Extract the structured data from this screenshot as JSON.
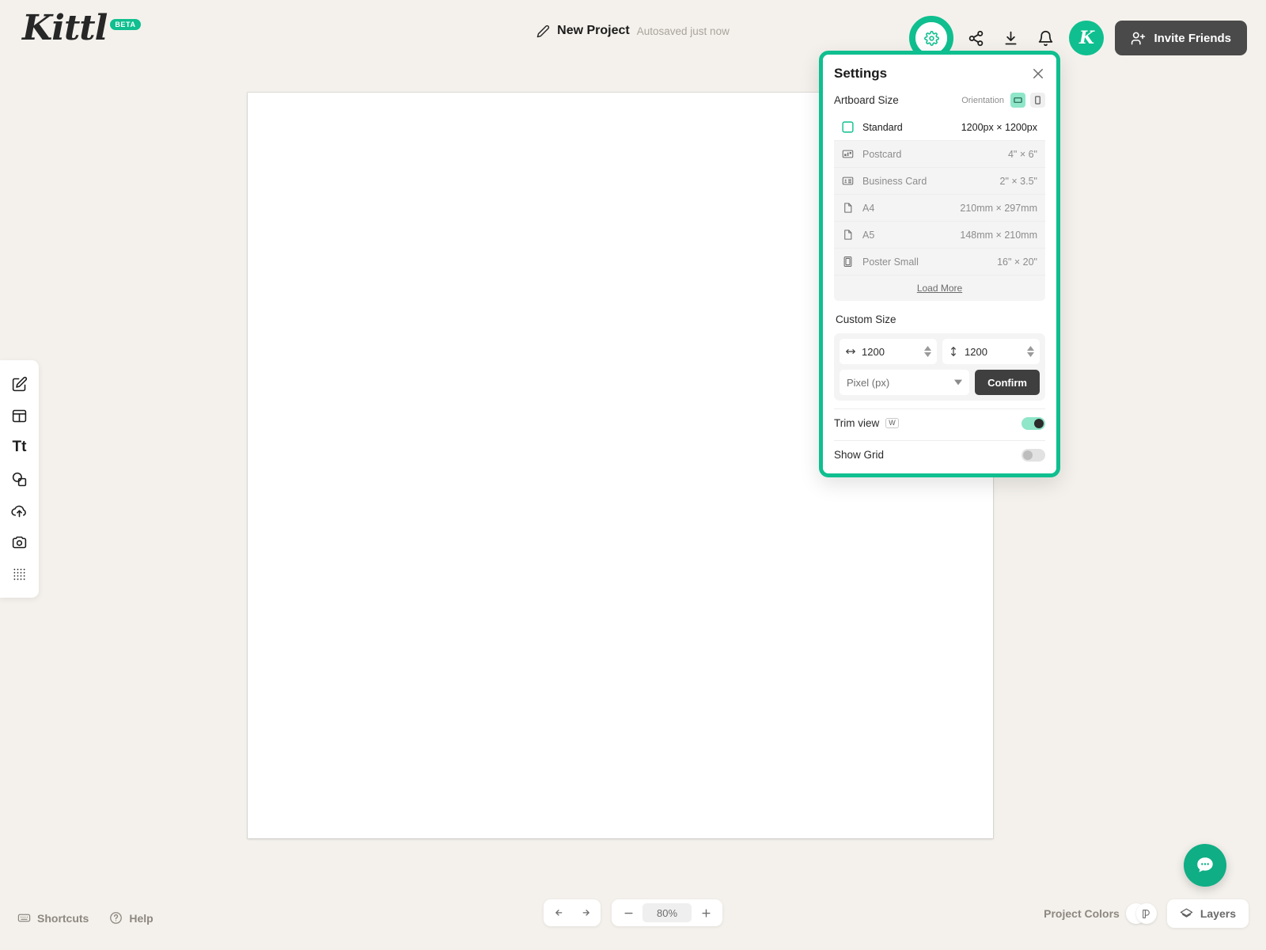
{
  "brand": {
    "name": "Kittl",
    "badge": "BETA",
    "accent": "#0fbf8f"
  },
  "header": {
    "project_name": "New Project",
    "autosave_status": "Autosaved just now",
    "invite_label": "Invite Friends",
    "avatar_initial": "K",
    "icons": [
      "gear-icon",
      "share-icon",
      "download-icon",
      "bell-icon"
    ]
  },
  "sidebar": {
    "items": [
      {
        "name": "draw-edit",
        "label": "Draw"
      },
      {
        "name": "templates",
        "label": "Templates"
      },
      {
        "name": "text",
        "label": "Tt"
      },
      {
        "name": "shapes",
        "label": "Shapes"
      },
      {
        "name": "uploads",
        "label": "Uploads"
      },
      {
        "name": "photos",
        "label": "Photos"
      },
      {
        "name": "elements",
        "label": "Elements"
      }
    ]
  },
  "settings": {
    "title": "Settings",
    "artboard_label": "Artboard Size",
    "orientation_label": "Orientation",
    "orientation_selected": "landscape",
    "sizes": [
      {
        "icon": "square-icon",
        "name": "Standard",
        "dim": "1200px × 1200px",
        "selected": true
      },
      {
        "icon": "postcard-icon",
        "name": "Postcard",
        "dim": "4\" × 6\"",
        "selected": false
      },
      {
        "icon": "business-card-icon",
        "name": "Business Card",
        "dim": "2\" × 3.5\"",
        "selected": false
      },
      {
        "icon": "page-icon",
        "name": "A4",
        "dim": "210mm × 297mm",
        "selected": false
      },
      {
        "icon": "page-icon",
        "name": "A5",
        "dim": "148mm × 210mm",
        "selected": false
      },
      {
        "icon": "poster-icon",
        "name": "Poster Small",
        "dim": "16\" × 20\"",
        "selected": false
      }
    ],
    "load_more_label": "Load More",
    "custom_size_label": "Custom Size",
    "width_value": "1200",
    "height_value": "1200",
    "unit_value": "Pixel (px)",
    "confirm_label": "Confirm",
    "trim_view_label": "Trim view",
    "trim_view_shortcut": "W",
    "trim_view_on": true,
    "show_grid_label": "Show Grid",
    "show_grid_on": false
  },
  "footer": {
    "shortcuts_label": "Shortcuts",
    "help_label": "Help",
    "zoom_value": "80%",
    "project_colors_label": "Project Colors",
    "layers_label": "Layers"
  }
}
